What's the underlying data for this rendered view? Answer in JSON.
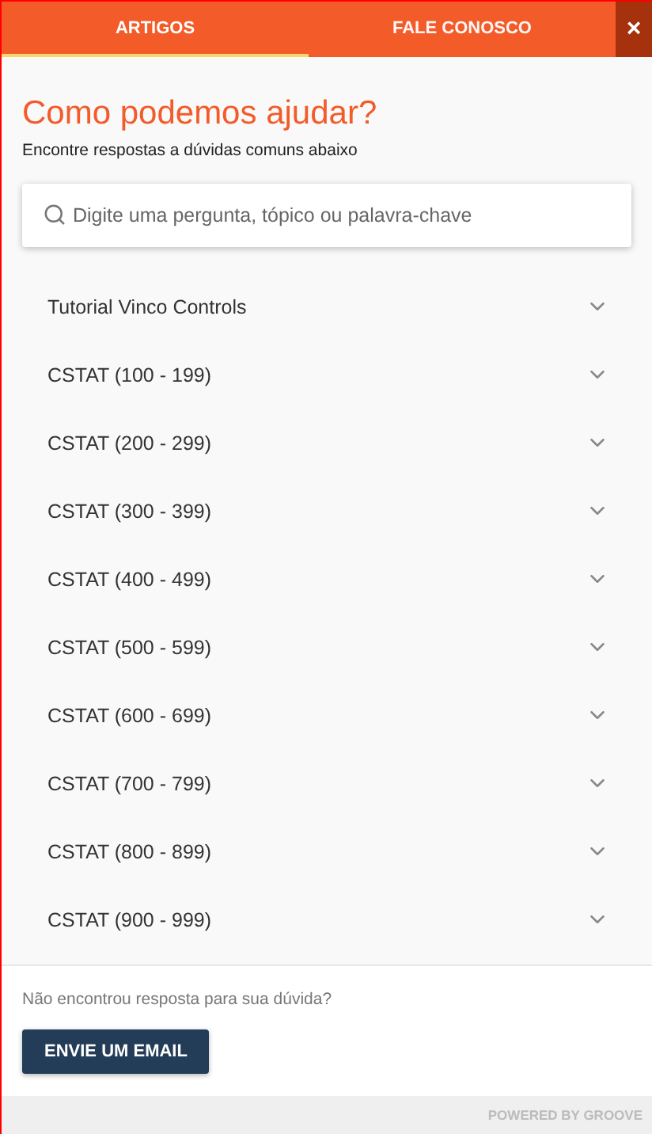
{
  "tabs": [
    {
      "label": "ARTIGOS",
      "selected": true
    },
    {
      "label": "FALE CONOSCO",
      "selected": false
    }
  ],
  "close": "×",
  "heading": "Como podemos ajudar?",
  "subheading": "Encontre respostas a dúvidas comuns abaixo",
  "search": {
    "placeholder": "Digite uma pergunta, tópico ou palavra-chave"
  },
  "categories": [
    {
      "label": "Tutorial Vinco Controls",
      "expanded": false
    },
    {
      "label": "CSTAT (100 - 199)",
      "expanded": false
    },
    {
      "label": "CSTAT (200 - 299)",
      "expanded": false
    },
    {
      "label": "CSTAT (300 - 399)",
      "expanded": false
    },
    {
      "label": "CSTAT (400 - 499)",
      "expanded": false
    },
    {
      "label": "CSTAT (500 - 599)",
      "expanded": false
    },
    {
      "label": "CSTAT (600 - 699)",
      "expanded": false
    },
    {
      "label": "CSTAT (700 - 799)",
      "expanded": false
    },
    {
      "label": "CSTAT (800 - 899)",
      "expanded": false
    },
    {
      "label": "CSTAT (900 - 999)",
      "expanded": false
    }
  ],
  "footer": {
    "question": "Não encontrou resposta para sua dúvida?",
    "button": "ENVIE UM EMAIL"
  },
  "powered_by": "POWERED BY GROOVE"
}
